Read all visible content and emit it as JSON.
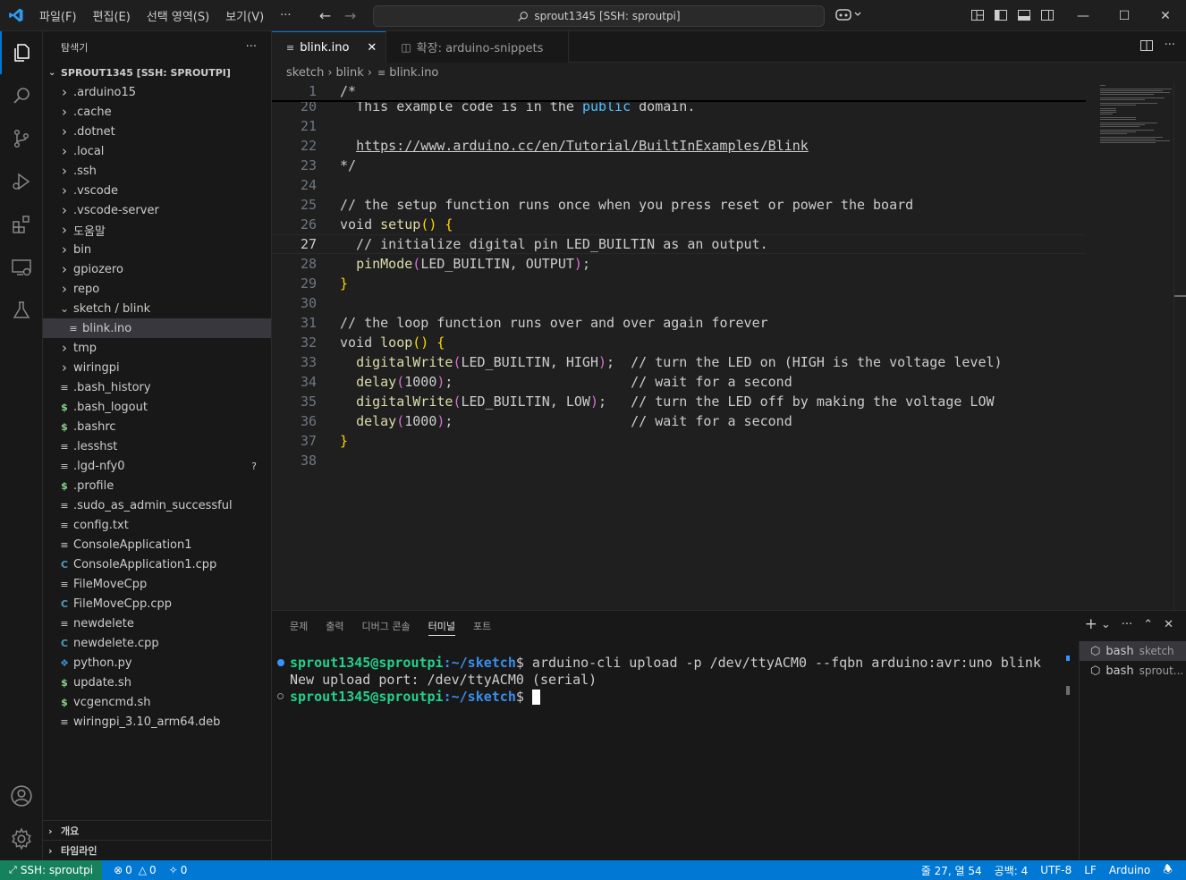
{
  "titlebar": {
    "menus": [
      "파일(F)",
      "편집(E)",
      "선택 영역(S)",
      "보기(V)",
      "···"
    ],
    "command_center": "sprout1345 [SSH: sproutpi]"
  },
  "sidebar": {
    "title": "탐색기",
    "more": "···",
    "root": "SPROUT1345 [SSH: SPROUTPI]",
    "items": [
      {
        "label": ".arduino15",
        "type": "folder"
      },
      {
        "label": ".cache",
        "type": "folder"
      },
      {
        "label": ".dotnet",
        "type": "folder"
      },
      {
        "label": ".local",
        "type": "folder"
      },
      {
        "label": ".ssh",
        "type": "folder"
      },
      {
        "label": ".vscode",
        "type": "folder"
      },
      {
        "label": ".vscode-server",
        "type": "folder"
      },
      {
        "label": "도움말",
        "type": "folder"
      },
      {
        "label": "bin",
        "type": "folder"
      },
      {
        "label": "gpiozero",
        "type": "folder"
      },
      {
        "label": "repo",
        "type": "folder"
      },
      {
        "label": "sketch / blink",
        "type": "folder-open"
      },
      {
        "label": "blink.ino",
        "type": "file-lines",
        "selected": true,
        "indent": 1
      },
      {
        "label": "tmp",
        "type": "folder"
      },
      {
        "label": "wiringpi",
        "type": "folder"
      },
      {
        "label": ".bash_history",
        "type": "file-lines"
      },
      {
        "label": ".bash_logout",
        "type": "shell"
      },
      {
        "label": ".bashrc",
        "type": "shell"
      },
      {
        "label": ".lesshst",
        "type": "file-lines"
      },
      {
        "label": ".lgd-nfy0",
        "type": "file-lines",
        "badge": "?"
      },
      {
        "label": ".profile",
        "type": "shell"
      },
      {
        "label": ".sudo_as_admin_successful",
        "type": "file-lines"
      },
      {
        "label": "config.txt",
        "type": "file-lines"
      },
      {
        "label": "ConsoleApplication1",
        "type": "file-lines"
      },
      {
        "label": "ConsoleApplication1.cpp",
        "type": "cpp"
      },
      {
        "label": "FileMoveCpp",
        "type": "file-lines"
      },
      {
        "label": "FileMoveCpp.cpp",
        "type": "cpp"
      },
      {
        "label": "newdelete",
        "type": "file-lines"
      },
      {
        "label": "newdelete.cpp",
        "type": "cpp"
      },
      {
        "label": "python.py",
        "type": "python"
      },
      {
        "label": "update.sh",
        "type": "shell"
      },
      {
        "label": "vcgencmd.sh",
        "type": "shell"
      },
      {
        "label": "wiringpi_3.10_arm64.deb",
        "type": "file-lines"
      }
    ],
    "outline": "개요",
    "timeline": "타임라인"
  },
  "editor": {
    "tabs": [
      {
        "label": "blink.ino",
        "active": true
      },
      {
        "label": "확장: arduino-snippets",
        "active": false
      }
    ],
    "breadcrumb": [
      "sketch",
      "blink",
      "blink.ino"
    ],
    "sticky_line": {
      "num": "1",
      "text": "/*"
    },
    "lines": [
      {
        "num": "20",
        "html": "  This example code is in the <span class='kw2'>public</span> domain."
      },
      {
        "num": "21",
        "html": ""
      },
      {
        "num": "22",
        "html": "  <span class='lnk'>https://www.arduino.cc/en/Tutorial/BuiltInExamples/Blink</span>"
      },
      {
        "num": "23",
        "html": "*/"
      },
      {
        "num": "24",
        "html": ""
      },
      {
        "num": "25",
        "html": "// the setup function runs once when you press reset or power the board"
      },
      {
        "num": "26",
        "html": "void <span class='fn'>setup</span><span class='brk'>()</span> <span class='brk'>{</span>"
      },
      {
        "num": "27",
        "html": "  // initialize digital pin LED_BUILTIN as an output.",
        "current": true
      },
      {
        "num": "28",
        "html": "  <span class='fn'>pinMode</span><span class='brk2'>(</span>LED_BUILTIN, OUTPUT<span class='brk2'>)</span>;"
      },
      {
        "num": "29",
        "html": "<span class='brk'>}</span>"
      },
      {
        "num": "30",
        "html": ""
      },
      {
        "num": "31",
        "html": "// the loop function runs over and over again forever"
      },
      {
        "num": "32",
        "html": "void <span class='fn'>loop</span><span class='brk'>()</span> <span class='brk'>{</span>"
      },
      {
        "num": "33",
        "html": "  <span class='fn'>digitalWrite</span><span class='brk2'>(</span>LED_BUILTIN, HIGH<span class='brk2'>)</span>;  // turn the LED on (HIGH is the voltage level)"
      },
      {
        "num": "34",
        "html": "  <span class='fn'>delay</span><span class='brk2'>(</span>1000<span class='brk2'>)</span>;                      // wait for a second"
      },
      {
        "num": "35",
        "html": "  <span class='fn'>digitalWrite</span><span class='brk2'>(</span>LED_BUILTIN, LOW<span class='brk2'>)</span>;   // turn the LED off by making the voltage LOW"
      },
      {
        "num": "36",
        "html": "  <span class='fn'>delay</span><span class='brk2'>(</span>1000<span class='brk2'>)</span>;                      // wait for a second"
      },
      {
        "num": "37",
        "html": "<span class='brk'>}</span>"
      },
      {
        "num": "38",
        "html": ""
      }
    ]
  },
  "panel": {
    "tabs": [
      "문제",
      "출력",
      "디버그 콘솔",
      "터미널",
      "포트"
    ],
    "active_tab": "터미널",
    "terminal": {
      "prompt_user": "sprout1345@sproutpi",
      "prompt_path": ":~/sketch",
      "prompt_sym": "$",
      "command": " arduino-cli upload -p /dev/ttyACM0 --fqbn arduino:avr:uno blink",
      "output": "New upload port: /dev/ttyACM0 (serial)"
    },
    "terminals": [
      {
        "label": "bash",
        "sub": "sketch"
      },
      {
        "label": "bash",
        "sub": "sprout..."
      }
    ]
  },
  "statusbar": {
    "remote": "SSH: sproutpi",
    "errors": "0",
    "warnings": "0",
    "ports": "0",
    "position": "줄 27, 열 54",
    "spaces": "공백: 4",
    "encoding": "UTF-8",
    "eol": "LF",
    "language": "Arduino"
  },
  "colors": {
    "accent": "#0078d4",
    "remote": "#16825d",
    "prompt": "#23d18b"
  }
}
